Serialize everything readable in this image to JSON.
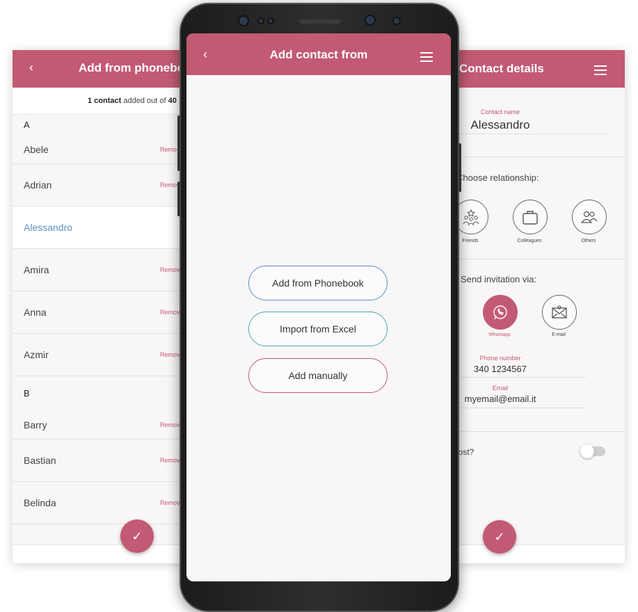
{
  "left": {
    "header_title": "Add from phonebo",
    "back_icon": "‹",
    "count": {
      "bold": "1 contact",
      "mid": " added out of ",
      "total": "40"
    },
    "sections": [
      {
        "letter": "A",
        "rows": [
          {
            "name": "Abele",
            "action": "Remo"
          },
          {
            "name": "Adrian",
            "action": "Remov"
          },
          {
            "name": "Alessandro",
            "action": "",
            "selected": true
          },
          {
            "name": "Amira",
            "action": "Remov"
          },
          {
            "name": "Anna",
            "action": "Remov"
          },
          {
            "name": "Azmir",
            "action": "Remov"
          }
        ]
      },
      {
        "letter": "B",
        "rows": [
          {
            "name": "Barry",
            "action": "Remov"
          },
          {
            "name": "Bastian",
            "action": "Remov"
          },
          {
            "name": "Belinda",
            "action": "Remov"
          }
        ]
      }
    ],
    "fab_icon": "✓"
  },
  "phone": {
    "header_title": "Add contact from",
    "back_icon": "‹",
    "buttons": {
      "phonebook": "Add from Phonebook",
      "excel": "Import from Excel",
      "manual": "Add manually"
    }
  },
  "right": {
    "header_title": "Contact details",
    "contact_name_label": "Contact name",
    "contact_name": "Alessandro",
    "relationship_label": "Choose relationship:",
    "relationships": [
      "Friends",
      "Colleagues",
      "Others"
    ],
    "invitation_label": "Send invitation via:",
    "channels": [
      "Whatsapp",
      "E-mail"
    ],
    "phone_label": "Phone number",
    "phone_value": "340 1234567",
    "email_label": "Email",
    "email_value": "myemail@email.it",
    "host_question": "nost?",
    "fab_icon": "✓"
  },
  "colors": {
    "accent": "#c25a73",
    "link": "#5b8fc7",
    "teal": "#4aa7b4"
  }
}
